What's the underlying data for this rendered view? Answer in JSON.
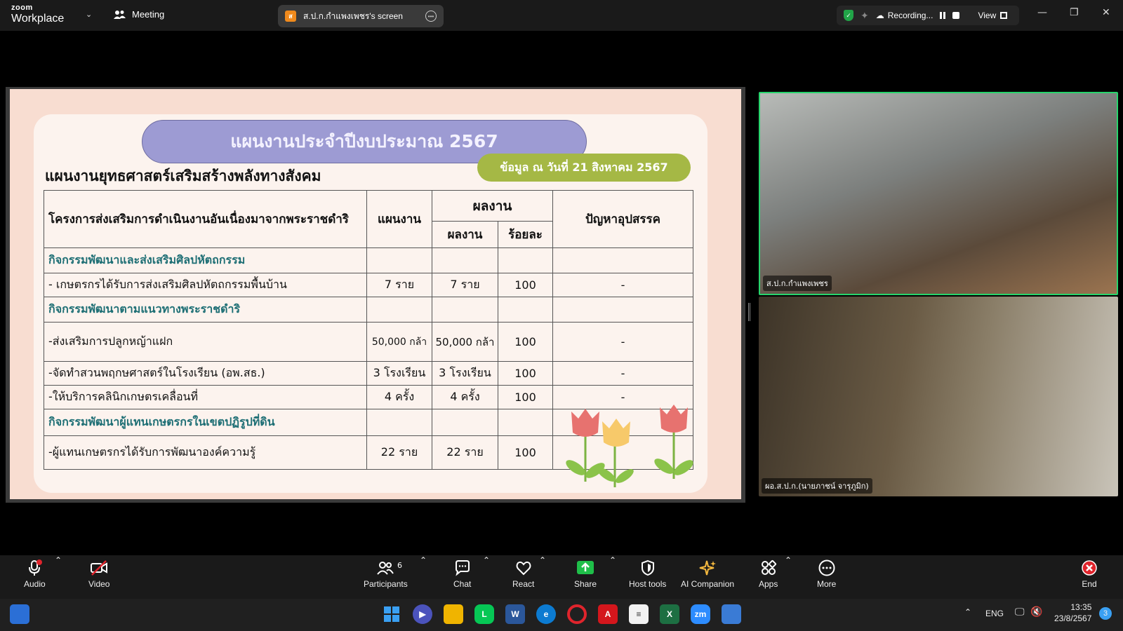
{
  "app": {
    "logo_top": "zoom",
    "logo_bottom": "Workplace",
    "meeting_label": "Meeting",
    "share_badge": "ส",
    "share_label": "ส.ป.ก.กำแพงเพชร's screen",
    "recording_label": "Recording...",
    "view_label": "View"
  },
  "slide": {
    "title": "แผนงานประจำปีงบประมาณ 2567",
    "date_note": "ข้อมูล ณ วันที่ 21 สิงหาคม 2567",
    "subtitle": "แผนงานยุทธศาสตร์เสริมสร้างพลังทางสังคม",
    "headers": {
      "project": "โครงการส่งเสริมการดำเนินงานอันเนื่องมาจากพระราชดำริ",
      "plan": "แผนงาน",
      "result_group": "ผลงาน",
      "result": "ผลงาน",
      "percent": "ร้อยละ",
      "problem": "ปัญหาอุปสรรค"
    },
    "rows": [
      {
        "type": "category",
        "label": "กิจกรรมพัฒนาและส่งเสริมศิลปหัตถกรรม"
      },
      {
        "type": "item",
        "label": "- เกษตรกรได้รับการส่งเสริมศิลปหัตถกรรมพื้นบ้าน",
        "plan": "7 ราย",
        "result": "7 ราย",
        "percent": "100",
        "problem": "-"
      },
      {
        "type": "category",
        "label": "กิจกรรมพัฒนาตามแนวทางพระราชดำริ"
      },
      {
        "type": "item",
        "label": "-ส่งเสริมการปลูกหญ้าแฝก",
        "plan": "50,000 กล้า",
        "result": "50,000 กล้า",
        "percent": "100",
        "problem": "-"
      },
      {
        "type": "item",
        "label": "-จัดทำสวนพฤกษศาสตร์ในโรงเรียน (อพ.สธ.)",
        "plan": "3 โรงเรียน",
        "result": "3 โรงเรียน",
        "percent": "100",
        "problem": "-"
      },
      {
        "type": "item",
        "label": "-ให้บริการคลินิกเกษตรเคลื่อนที่",
        "plan": "4 ครั้ง",
        "result": "4 ครั้ง",
        "percent": "100",
        "problem": "-"
      },
      {
        "type": "category",
        "label": "กิจกรรมพัฒนาผู้แทนเกษตรกรในเขตปฏิรูปที่ดิน"
      },
      {
        "type": "item",
        "label": "-ผู้แทนเกษตรกรได้รับการพัฒนาองค์ความรู้",
        "plan": "22 ราย",
        "result": "22 ราย",
        "percent": "100",
        "problem": ""
      }
    ]
  },
  "videos": {
    "top_label": "ส.ป.ก.กำแพงเพชร",
    "bottom_label": "ผอ.ส.ป.ก.(นายภาชน์ จารุภูมิก)"
  },
  "toolbar": {
    "audio": "Audio",
    "video": "Video",
    "participants": "Participants",
    "participants_count": "6",
    "chat": "Chat",
    "react": "React",
    "share": "Share",
    "host_tools": "Host tools",
    "ai_companion": "AI Companion",
    "apps": "Apps",
    "more": "More",
    "end": "End"
  },
  "taskbar": {
    "lang": "ENG",
    "time": "13:35",
    "date": "23/8/2567",
    "notif_count": "3"
  },
  "colors": {
    "accent_green": "#27d46c",
    "share_green": "#1fbf49",
    "end_red": "#e0242c",
    "title_purple": "#9d9bd3",
    "date_green": "#a5b845",
    "category_teal": "#1d6e74"
  }
}
